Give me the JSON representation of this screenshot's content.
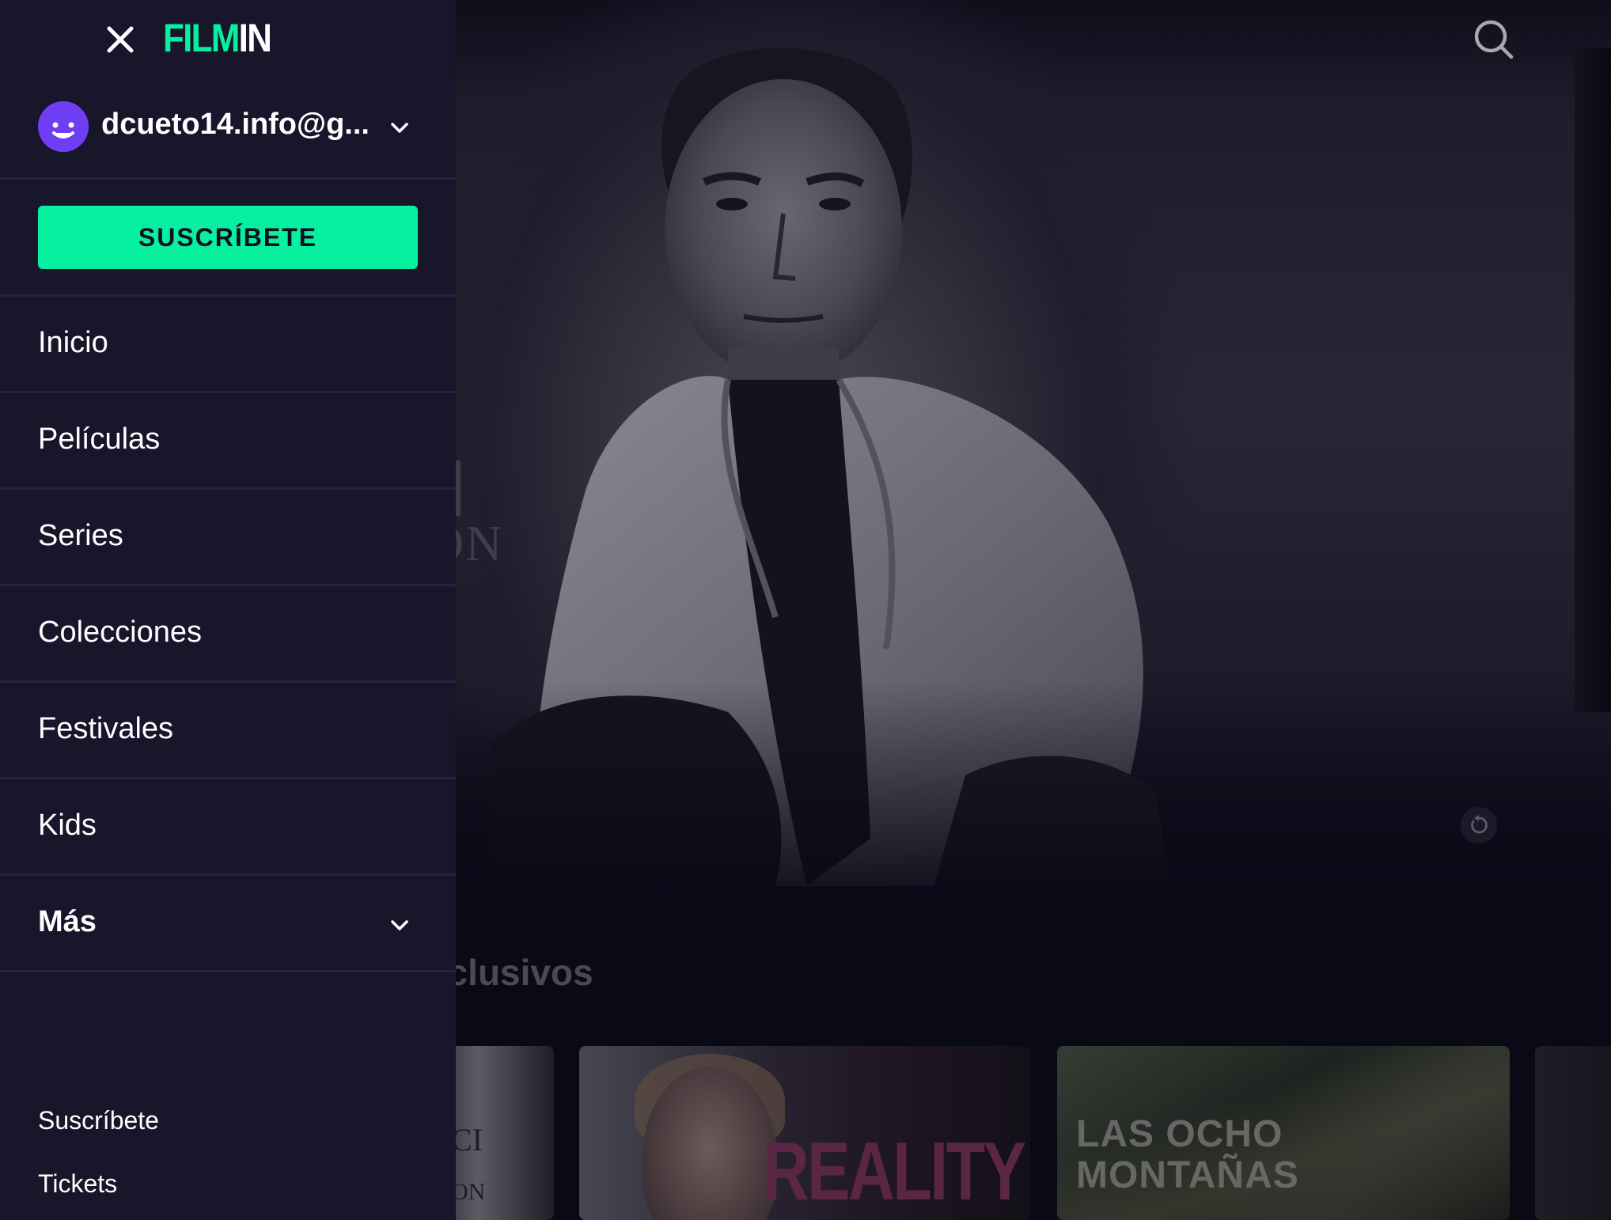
{
  "header": {
    "logo_part1": "FILM",
    "logo_part2": "IN",
    "close_icon": "close-icon",
    "search_icon": "search-icon"
  },
  "account": {
    "email": "dcueto14.info@g...",
    "avatar_icon": "smiley-avatar-icon",
    "chevron_icon": "chevron-down-icon"
  },
  "subscribe_button": "SUSCRÍBETE",
  "nav": {
    "items": [
      {
        "label": "Inicio"
      },
      {
        "label": "Películas"
      },
      {
        "label": "Series"
      },
      {
        "label": "Colecciones"
      },
      {
        "label": "Festivales"
      },
      {
        "label": "Kids"
      },
      {
        "label": "Más"
      }
    ]
  },
  "footer": {
    "links": [
      {
        "label": "Suscríbete"
      },
      {
        "label": "Tickets"
      }
    ]
  },
  "main": {
    "hero_ghost_text": "ON",
    "row_title": "xclusivos",
    "thumbnails": [
      {
        "text_top": "CI",
        "text_bottom": "ON"
      },
      {
        "text": "REALITY"
      },
      {
        "line1": "LAS OCHO",
        "line2": "MONTAÑAS"
      }
    ]
  },
  "colors": {
    "brand_green": "#07f0a0",
    "drawer_bg": "#17162a",
    "avatar": "#6e3df4",
    "page_bg": "#0c0b18"
  }
}
